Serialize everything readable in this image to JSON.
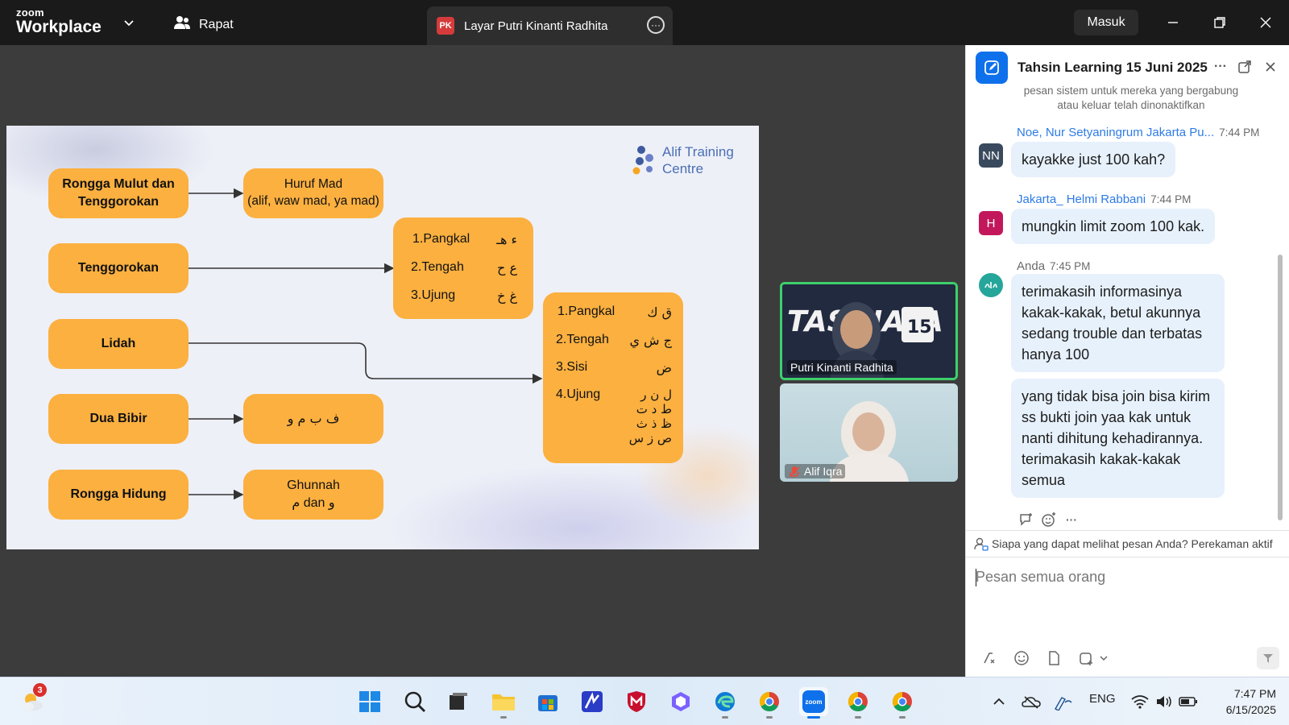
{
  "titlebar": {
    "logo_top": "zoom",
    "logo_bottom": "Workplace",
    "meetings_label": "Rapat",
    "tab_badge": "PK",
    "tab_title": "Layar Putri Kinanti Radhita",
    "signin_label": "Masuk"
  },
  "slide": {
    "brand_line1": "Alif Training",
    "brand_line2": "Centre",
    "left_boxes": [
      {
        "line1": "Rongga Mulut dan",
        "line2": "Tenggorokan"
      },
      {
        "line1": "Tenggorokan"
      },
      {
        "line1": "Lidah"
      },
      {
        "line1": "Dua Bibir"
      },
      {
        "line1": "Rongga Hidung"
      }
    ],
    "huruf_mad": {
      "line1": "Huruf Mad",
      "line2": "(alif, waw mad, ya mad)"
    },
    "dua_bibir_letters": "ف ب م و",
    "ghunnah": {
      "line1": "Ghunnah",
      "line2": "م dan و"
    },
    "throat_list": [
      {
        "label": "1.Pangkal",
        "letters": "ء هـ"
      },
      {
        "label": "2.Tengah",
        "letters": "ع ح"
      },
      {
        "label": "3.Ujung",
        "letters": "غ خ"
      }
    ],
    "tongue_list": [
      {
        "label": "1.Pangkal",
        "letters": "ق ك"
      },
      {
        "label": "2.Tengah",
        "letters": "ج ش ي"
      },
      {
        "label": "3.Sisi",
        "letters": "ض"
      },
      {
        "label": "4.Ujung",
        "letters": "ل ن ر",
        "letters2": "ط د ت",
        "letters3": "ظ ذ ث",
        "letters4": "ص ز س"
      }
    ]
  },
  "videos": [
    {
      "name": "Putri Kinanti Radhita",
      "banner_text": "TAS HAFA",
      "badge": "15"
    },
    {
      "name": "Alif Iqra"
    }
  ],
  "chat": {
    "title": "Tahsin Learning 15 Juni 2025",
    "system_line1": "pesan sistem untuk mereka yang bergabung",
    "system_line2": "atau keluar telah dinonaktifkan",
    "messages": [
      {
        "sender": "Noe, Nur Setyaningrum Jakarta Pu...",
        "time": "7:44 PM",
        "avatar": "NN",
        "text": "kayakke just 100 kah?"
      },
      {
        "sender": "Jakarta_ Helmi Rabbani",
        "time": "7:44 PM",
        "avatar": "H",
        "text": "mungkin limit zoom 100 kak."
      },
      {
        "sender": "Anda",
        "time": "7:45 PM",
        "avatar": "alif",
        "text": "terimakasih informasinya kakak-kakak, betul akunnya sedang trouble dan terbatas hanya 100",
        "text2": "yang tidak bisa join bisa kirim ss bukti join yaa kak untuk nanti dihitung kehadirannya. terimakasih kakak-kakak semua"
      }
    ],
    "privacy_text": "Siapa yang dapat melihat pesan Anda? Perekaman aktif",
    "compose_placeholder": "Pesan semua orang"
  },
  "taskbar": {
    "weather_badge": "3",
    "language": "ENG",
    "time": "7:47 PM",
    "date": "6/15/2025"
  },
  "colors": {
    "accent": "#0e71eb",
    "slide_box": "#fbb040",
    "active_speaker": "#3ecf6b",
    "bubble": "#e7f1fc"
  }
}
